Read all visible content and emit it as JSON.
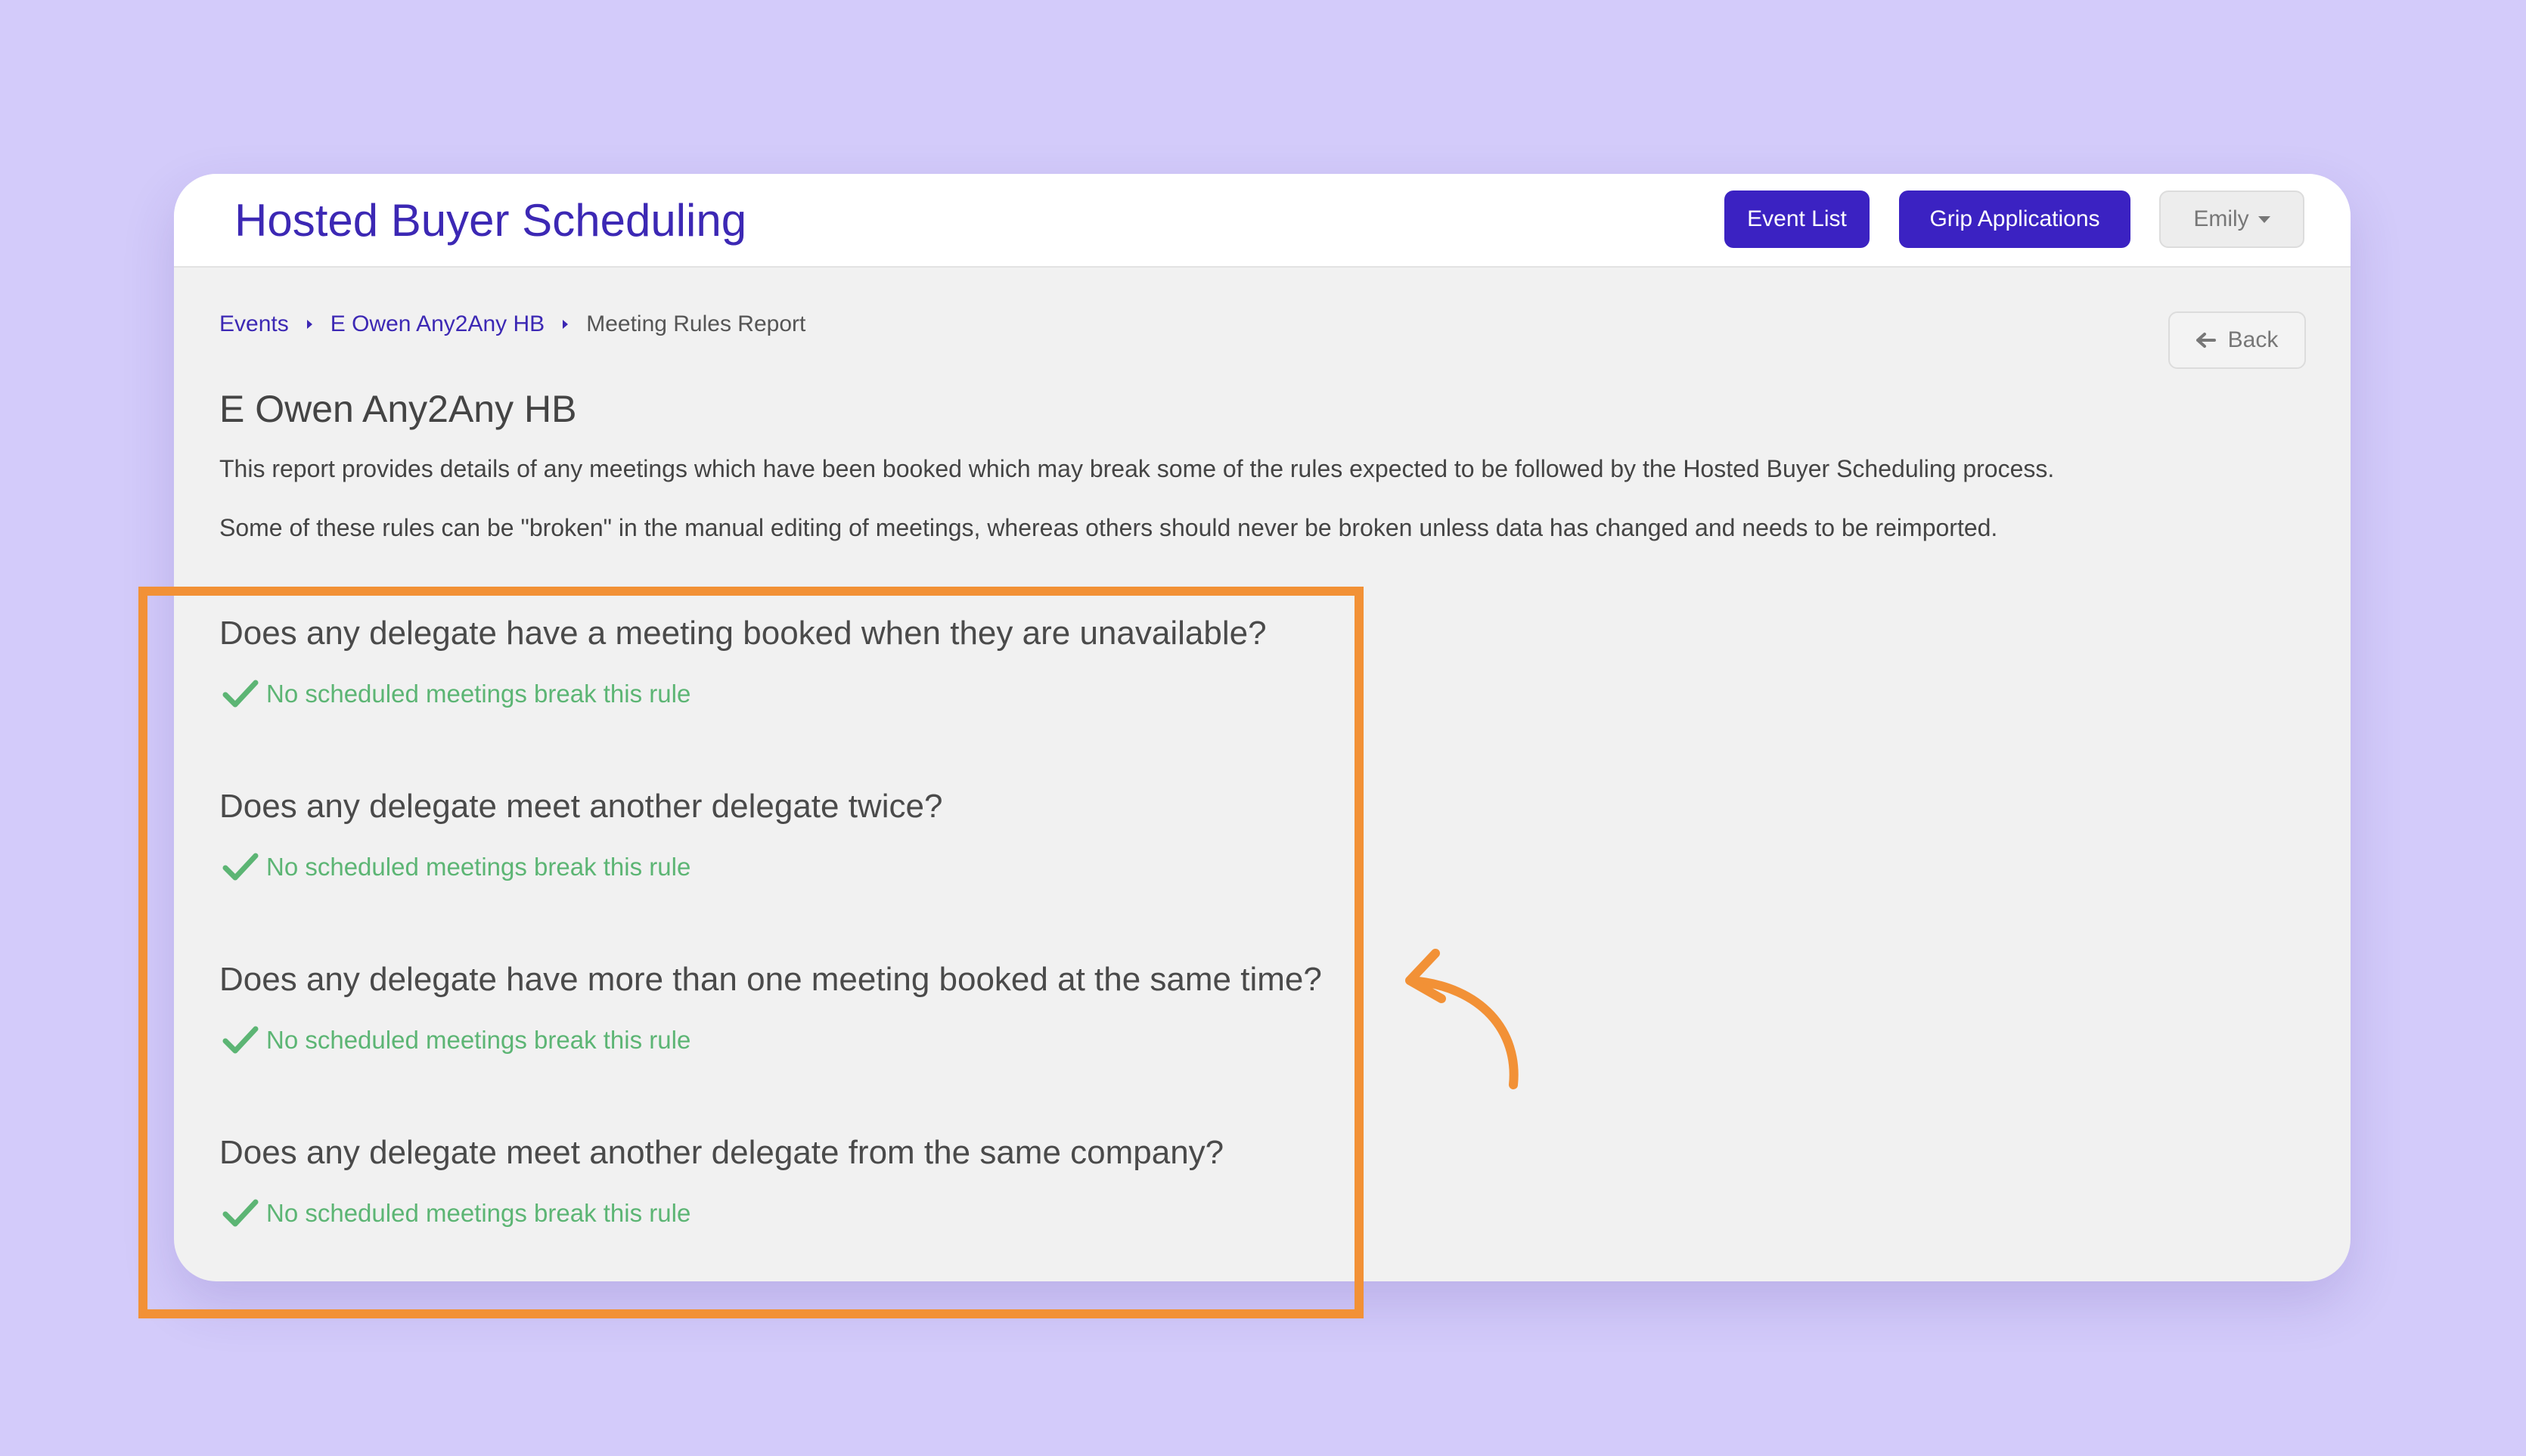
{
  "header": {
    "app_title": "Hosted Buyer Scheduling",
    "event_list_label": "Event List",
    "grip_applications_label": "Grip Applications",
    "user_menu_label": "Emily"
  },
  "breadcrumb": {
    "items": [
      "Events",
      "E Owen Any2Any HB"
    ],
    "current": "Meeting Rules Report"
  },
  "back_label": "Back",
  "page": {
    "title": "E Owen Any2Any HB",
    "description_1": "This report provides details of any meetings which have been booked which may break some of the rules expected to be followed by the Hosted Buyer Scheduling process.",
    "description_2": "Some of these rules can be \"broken\" in the manual editing of meetings, whereas others should never be broken unless data has changed and needs to be reimported."
  },
  "rules": [
    {
      "question": "Does any delegate have a meeting booked when they are unavailable?",
      "status": "No scheduled meetings break this rule"
    },
    {
      "question": "Does any delegate meet another delegate twice?",
      "status": "No scheduled meetings break this rule"
    },
    {
      "question": "Does any delegate have more than one meeting booked at the same time?",
      "status": "No scheduled meetings break this rule"
    },
    {
      "question": "Does any delegate meet another delegate from the same company?",
      "status": "No scheduled meetings break this rule"
    }
  ],
  "colors": {
    "background": "#d3cbfa",
    "brand": "#3c28b4",
    "primary_button": "#3b22c2",
    "success": "#5cb574",
    "annotation": "#f29136"
  }
}
